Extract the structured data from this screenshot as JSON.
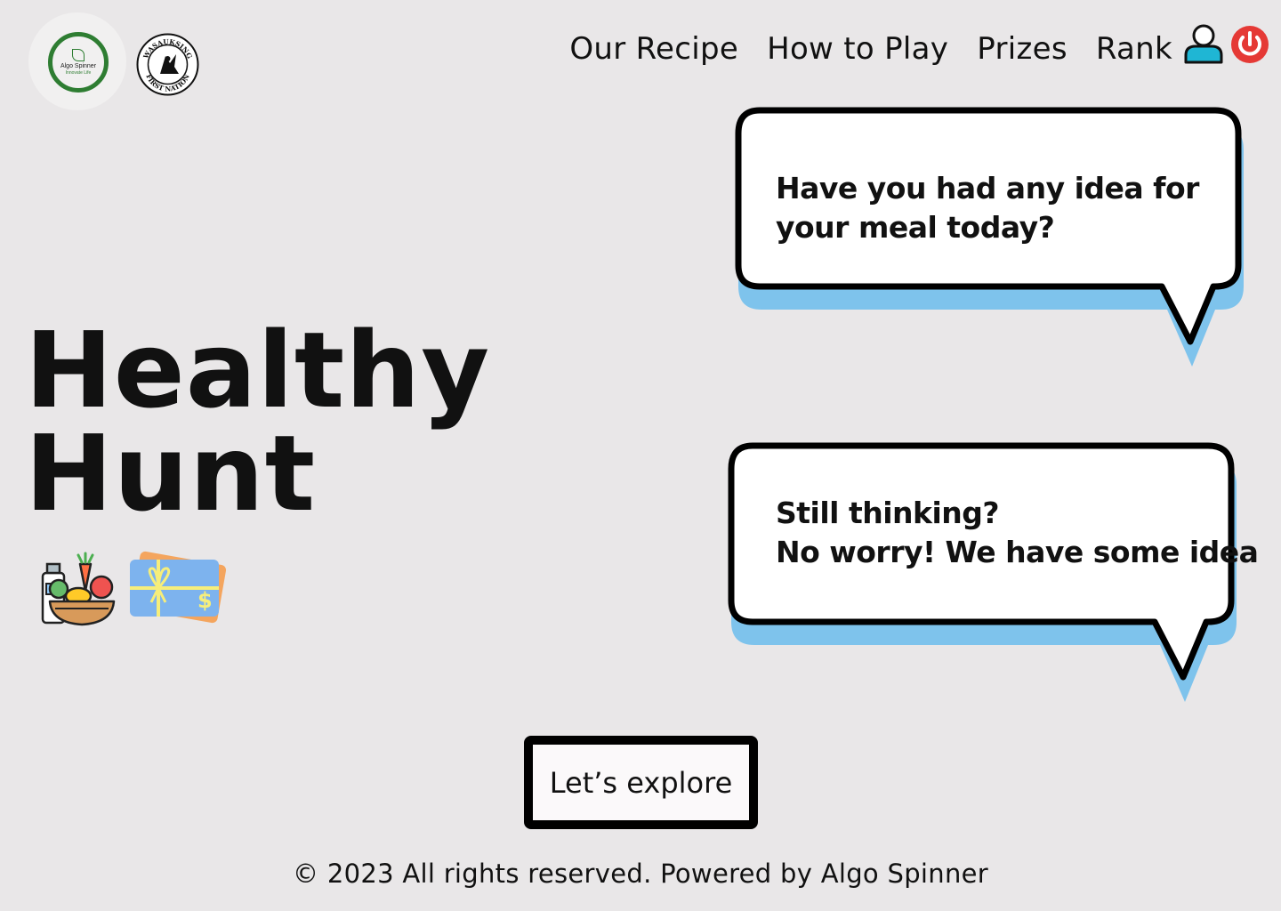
{
  "header": {
    "logo_name": "Algo Spinner",
    "logo_tagline": "Innovate Life",
    "partner_seal_top_text": "WASAUKSING",
    "partner_seal_bottom_text": "FIRST NATION",
    "nav": [
      {
        "label": "Our Recipe"
      },
      {
        "label": "How to Play"
      },
      {
        "label": "Prizes"
      },
      {
        "label": "Rank"
      }
    ],
    "icons": {
      "profile": "user-profile-icon",
      "logout": "power-icon"
    },
    "colors": {
      "profile": "#1fb6d4",
      "logout": "#e53935"
    }
  },
  "hero": {
    "title_line1": "Healthy",
    "title_line2": "Hunt",
    "icons": [
      "grocery-basket-icon",
      "gift-card-icon"
    ]
  },
  "bubbles": [
    {
      "lines": [
        "Have you had any idea for",
        "your meal today?"
      ]
    },
    {
      "lines": [
        "Still thinking?",
        "No worry! We have some idea"
      ]
    }
  ],
  "colors": {
    "bubble_shadow": "#7ec3ec",
    "background": "#e9e7e8"
  },
  "cta": {
    "label": "Let’s explore"
  },
  "footer": {
    "text": "© 2023 All rights reserved. Powered by Algo Spinner"
  }
}
